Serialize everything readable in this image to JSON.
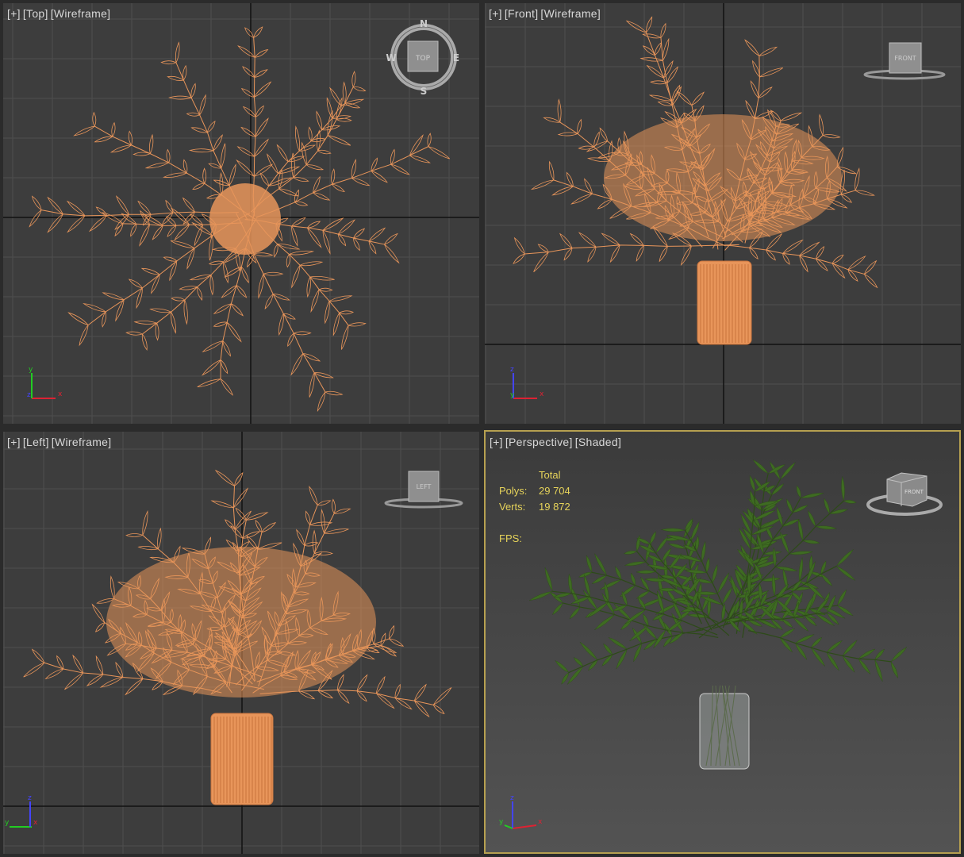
{
  "viewports": {
    "top": {
      "plus": "[+]",
      "view": "[Top]",
      "mode": "[Wireframe]",
      "cube_label": "TOP",
      "compass": {
        "n": "N",
        "s": "S",
        "e": "E",
        "w": "W"
      }
    },
    "front": {
      "plus": "[+]",
      "view": "[Front]",
      "mode": "[Wireframe]",
      "cube_label": "FRONT"
    },
    "left": {
      "plus": "[+]",
      "view": "[Left]",
      "mode": "[Wireframe]",
      "cube_label": "LEFT"
    },
    "perspective": {
      "plus": "[+]",
      "view": "[Perspective]",
      "mode": "[Shaded]",
      "cube_label": "FRONT"
    }
  },
  "stats": {
    "header": "Total",
    "polys_label": "Polys:",
    "polys": "29 704",
    "verts_label": "Verts:",
    "verts": "19 872",
    "fps_label": "FPS:"
  },
  "axes": {
    "x": "x",
    "y": "y",
    "z": "z"
  },
  "colors": {
    "viewport_bg": "#3d3d3d",
    "grid": "#4e4e4e",
    "wire": "#e8955a",
    "active_border": "#b6a050",
    "stats_text": "#e6d35a",
    "leaf": "#3e6b22"
  }
}
